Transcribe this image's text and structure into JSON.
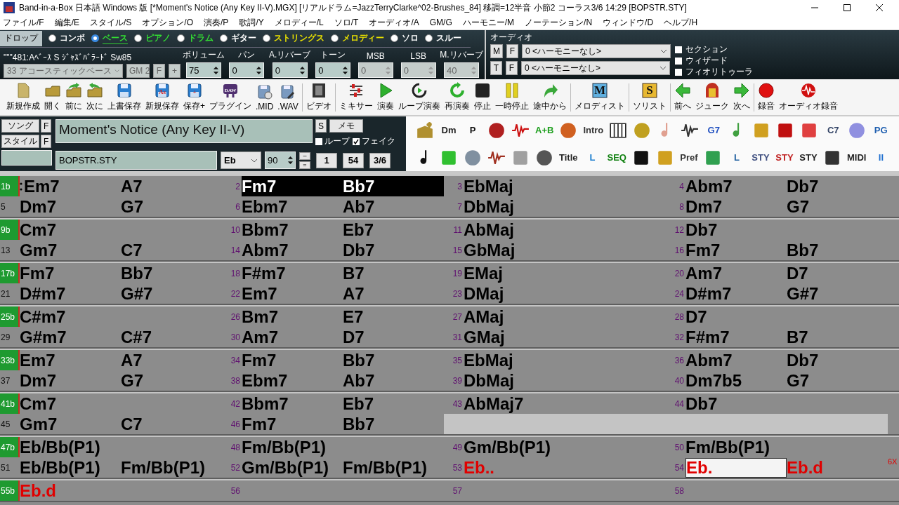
{
  "window": {
    "title": "Band-in-a-Box 日本語 Windows 版  [*Moment's Notice (Any Key II-V).MGX] [リアルドラム=JazzTerryClarke^02-Brushes_84] 移調=12半音 小節2 コーラス3/6  14:29  [BOPSTR.STY]"
  },
  "menu": [
    "ファイル/F",
    "編集/E",
    "スタイル/S",
    "オプション/O",
    "演奏/P",
    "歌詞/Y",
    "メロディー/L",
    "ソロ/T",
    "オーディオ/A",
    "GM/G",
    "ハーモニー/M",
    "ノーテーション/N",
    "ウィンドウ/D",
    "ヘルプ/H"
  ],
  "tracks": {
    "drop_button": "ドロップ",
    "items": [
      {
        "label": "コンボ",
        "color": "#ffffff",
        "selected": false
      },
      {
        "label": "ベース",
        "color": "#33dd33",
        "selected": true
      },
      {
        "label": "ピアノ",
        "color": "#33dd33",
        "selected": false
      },
      {
        "label": "ドラム",
        "color": "#33dd33",
        "selected": false
      },
      {
        "label": "ギター",
        "color": "#ffffff",
        "selected": false
      },
      {
        "label": "ストリングス",
        "color": "#e8e000",
        "selected": false
      },
      {
        "label": "メロディー",
        "color": "#e8e000",
        "selected": false
      },
      {
        "label": "ソロ",
        "color": "#ffffff",
        "selected": false
      },
      {
        "label": "スルー",
        "color": "#ffffff",
        "selected": false
      }
    ]
  },
  "patch": {
    "name": "\"\"\"481:Aﾍﾞｰｽ S ｼﾞｬｽﾞﾊﾞﾗｰﾄﾞ Sw85",
    "instrument": "33 アコースティックベース",
    "disabled": true,
    "buttons": [
      "GM 2",
      "F",
      "+"
    ]
  },
  "params": [
    {
      "label": "ボリューム",
      "value": "75",
      "disabled": false
    },
    {
      "label": "パン",
      "value": "0",
      "disabled": false
    },
    {
      "label": "A.リバーブ",
      "value": "0",
      "disabled": false
    },
    {
      "label": "トーン",
      "value": "0",
      "disabled": false
    },
    {
      "label": "MSB",
      "value": "0",
      "disabled": true
    },
    {
      "label": "LSB",
      "value": "0",
      "disabled": true
    },
    {
      "label": "M.リバーブ",
      "value": "40",
      "disabled": true
    }
  ],
  "audio": {
    "title": "オーディオ",
    "rows": [
      {
        "buttons": [
          "M",
          "F"
        ],
        "harmony": "0 <ハーモニーなし>"
      },
      {
        "buttons": [
          "T",
          "F"
        ],
        "harmony": "0 <ハーモニーなし>"
      }
    ],
    "options": [
      {
        "label": "セクション",
        "checked": false
      },
      {
        "label": "ウィザード",
        "checked": false
      },
      {
        "label": "フィオリトゥーラ",
        "checked": false
      }
    ]
  },
  "toolbar": [
    [
      {
        "label": "新規作成",
        "kind": "page"
      },
      {
        "label": "開く",
        "kind": "folder"
      },
      {
        "label": "前に",
        "kind": "folder-back"
      },
      {
        "label": "次に",
        "kind": "folder-next"
      },
      {
        "label": "上書保存",
        "kind": "disk"
      },
      {
        "label": "新規保存",
        "kind": "disk-text",
        "glyph": "As"
      },
      {
        "label": "保存+",
        "kind": "disk-text",
        "glyph": "+"
      },
      {
        "label": "プラグイン",
        "kind": "daw",
        "glyph": "DAW"
      },
      {
        "label": ".MID",
        "kind": "disk-dots"
      },
      {
        "label": ".WAV",
        "kind": "disk-mic"
      }
    ],
    [
      {
        "label": "ビデオ",
        "kind": "film"
      }
    ],
    [
      {
        "label": "ミキサー",
        "kind": "mixer"
      },
      {
        "label": "演奏",
        "kind": "play"
      },
      {
        "label": "ループ演奏",
        "kind": "loop"
      },
      {
        "label": "再演奏",
        "kind": "replay"
      },
      {
        "label": "停止",
        "kind": "stop"
      },
      {
        "label": "一時停止",
        "kind": "pause"
      },
      {
        "label": "途中から",
        "kind": "arrow"
      }
    ],
    [
      {
        "label": "メロディスト",
        "kind": "letter",
        "glyph": "M"
      }
    ],
    [
      {
        "label": "ソリスト",
        "kind": "letter-gold",
        "glyph": "S"
      }
    ],
    [
      {
        "label": "前へ",
        "kind": "left"
      },
      {
        "label": "ジューク",
        "kind": "jukebox"
      },
      {
        "label": "次へ",
        "kind": "right"
      }
    ],
    [
      {
        "label": "録音",
        "kind": "record"
      },
      {
        "label": "オーディオ録音",
        "kind": "audio-record"
      }
    ]
  ],
  "song": {
    "song_button": "ソング",
    "style_button": "スタイル",
    "f_buttons": [
      "F",
      "F"
    ],
    "title": "Moment's Notice (Any Key II-V)",
    "s_button": "S",
    "memo_button": "メモ",
    "loop": {
      "label": "ループ",
      "checked": false
    },
    "fake": {
      "label": "フェイク",
      "checked": true
    },
    "style": "BOPSTR.STY",
    "key": "Eb",
    "tempo": "90",
    "minus": "–",
    "equals": "=",
    "start_bar": "1",
    "end_bar": "54",
    "chorus": "3/6"
  },
  "icon_panel": [
    [
      {
        "kind": "heart",
        "color": "#b09030"
      },
      {
        "kind": "text",
        "text": "Dm",
        "color": "#222222"
      },
      {
        "kind": "text",
        "text": "P",
        "color": "#111111"
      },
      {
        "kind": "round",
        "color": "#b02020"
      },
      {
        "kind": "wave",
        "color": "#cc1010"
      },
      {
        "kind": "text",
        "text": "A+B",
        "color": "#20a020"
      },
      {
        "kind": "round",
        "color": "#d06020"
      },
      {
        "kind": "text",
        "text": "Intro",
        "color": "#333333"
      },
      {
        "kind": "keys",
        "color": "#222222"
      },
      {
        "kind": "round",
        "color": "#c0a020"
      },
      {
        "kind": "note",
        "color": "#e0a090"
      },
      {
        "kind": "wave",
        "color": "#333333"
      },
      {
        "kind": "text",
        "text": "G7",
        "color": "#2050c0"
      },
      {
        "kind": "note",
        "color": "#40a040"
      },
      {
        "kind": "box",
        "color": "#d0a020"
      },
      {
        "kind": "box",
        "color": "#c01010"
      },
      {
        "kind": "box",
        "color": "#e04040"
      },
      {
        "kind": "text",
        "text": "C7",
        "color": "#334466"
      },
      {
        "kind": "round",
        "color": "#9090e0"
      },
      {
        "kind": "text",
        "text": "PG",
        "color": "#2060b0"
      }
    ],
    [
      {
        "kind": "note",
        "color": "#111111"
      },
      {
        "kind": "box",
        "color": "#30c030"
      },
      {
        "kind": "round",
        "color": "#8090a0"
      },
      {
        "kind": "wave",
        "color": "#a03020"
      },
      {
        "kind": "box",
        "color": "#a0a0a0"
      },
      {
        "kind": "round",
        "color": "#555555"
      },
      {
        "kind": "text",
        "text": "Title",
        "color": "#222222"
      },
      {
        "kind": "text",
        "text": "L",
        "color": "#2080d0"
      },
      {
        "kind": "text",
        "text": "SEQ",
        "color": "#108010"
      },
      {
        "kind": "box",
        "color": "#111111"
      },
      {
        "kind": "box",
        "color": "#d0a020"
      },
      {
        "kind": "text",
        "text": "Pref",
        "color": "#333333"
      },
      {
        "kind": "box",
        "color": "#30a050"
      },
      {
        "kind": "text",
        "text": "L",
        "color": "#2060a0"
      },
      {
        "kind": "text",
        "text": "STY",
        "color": "#405080"
      },
      {
        "kind": "text",
        "text": "STY",
        "color": "#c02020"
      },
      {
        "kind": "text",
        "text": "STY",
        "color": "#222222"
      },
      {
        "kind": "box",
        "color": "#333333"
      },
      {
        "kind": "text",
        "text": "MIDI",
        "color": "#222222"
      },
      {
        "kind": "text",
        "text": "II",
        "color": "#2070d0"
      }
    ]
  ],
  "chord_sheet": [
    [
      {
        "cells": [
          {
            "number": "1b",
            "section": true,
            "repeat_start": true,
            "chords": [
              "Em7",
              "A7"
            ],
            "selected": false
          },
          {
            "number": "2",
            "chords": [
              "Fm7",
              "Bb7"
            ],
            "selected": true
          },
          {
            "number": "3",
            "chords": [
              "EbMaj"
            ],
            "selected": false
          },
          {
            "number": "4",
            "chords": [
              "Abm7",
              "Db7"
            ],
            "selected": false
          }
        ]
      },
      {
        "cells": [
          {
            "number": "5",
            "chords": [
              "Dm7",
              "G7"
            ],
            "selected": false
          },
          {
            "number": "6",
            "chords": [
              "Ebm7",
              "Ab7"
            ],
            "selected": false
          },
          {
            "number": "7",
            "chords": [
              "DbMaj"
            ],
            "selected": false
          },
          {
            "number": "8",
            "chords": [
              "Dm7",
              "G7"
            ],
            "selected": false
          }
        ]
      }
    ],
    [
      {
        "cells": [
          {
            "number": "9b",
            "section": true,
            "chords": [
              "Cm7"
            ],
            "selected": false
          },
          {
            "number": "10",
            "chords": [
              "Bbm7",
              "Eb7"
            ],
            "selected": false
          },
          {
            "number": "11",
            "chords": [
              "AbMaj"
            ],
            "selected": false
          },
          {
            "number": "12",
            "chords": [
              "Db7"
            ],
            "selected": false
          }
        ]
      },
      {
        "cells": [
          {
            "number": "13",
            "chords": [
              "Gm7",
              "C7"
            ],
            "selected": false
          },
          {
            "number": "14",
            "chords": [
              "Abm7",
              "Db7"
            ],
            "selected": false
          },
          {
            "number": "15",
            "chords": [
              "GbMaj"
            ],
            "selected": false
          },
          {
            "number": "16",
            "chords": [
              "Fm7",
              "Bb7"
            ],
            "selected": false
          }
        ]
      }
    ],
    [
      {
        "cells": [
          {
            "number": "17b",
            "section": true,
            "chords": [
              "Fm7",
              "Bb7"
            ],
            "selected": false
          },
          {
            "number": "18",
            "chords": [
              "F#m7",
              "B7"
            ],
            "selected": false
          },
          {
            "number": "19",
            "chords": [
              "EMaj"
            ],
            "selected": false
          },
          {
            "number": "20",
            "chords": [
              "Am7",
              "D7"
            ],
            "selected": false
          }
        ]
      },
      {
        "cells": [
          {
            "number": "21",
            "chords": [
              "D#m7",
              "G#7"
            ],
            "selected": false
          },
          {
            "number": "22",
            "chords": [
              "Em7",
              "A7"
            ],
            "selected": false
          },
          {
            "number": "23",
            "chords": [
              "DMaj"
            ],
            "selected": false
          },
          {
            "number": "24",
            "chords": [
              "D#m7",
              "G#7"
            ],
            "selected": false
          }
        ]
      }
    ],
    [
      {
        "cells": [
          {
            "number": "25b",
            "section": true,
            "chords": [
              "C#m7"
            ],
            "selected": false
          },
          {
            "number": "26",
            "chords": [
              "Bm7",
              "E7"
            ],
            "selected": false
          },
          {
            "number": "27",
            "chords": [
              "AMaj"
            ],
            "selected": false
          },
          {
            "number": "28",
            "chords": [
              "D7"
            ],
            "selected": false
          }
        ]
      },
      {
        "cells": [
          {
            "number": "29",
            "chords": [
              "G#m7",
              "C#7"
            ],
            "selected": false
          },
          {
            "number": "30",
            "chords": [
              "Am7",
              "D7"
            ],
            "selected": false
          },
          {
            "number": "31",
            "chords": [
              "GMaj"
            ],
            "selected": false
          },
          {
            "number": "32",
            "chords": [
              "F#m7",
              "B7"
            ],
            "selected": false
          }
        ]
      }
    ],
    [
      {
        "cells": [
          {
            "number": "33b",
            "section": true,
            "chords": [
              "Em7",
              "A7"
            ],
            "selected": false
          },
          {
            "number": "34",
            "chords": [
              "Fm7",
              "Bb7"
            ],
            "selected": false
          },
          {
            "number": "35",
            "chords": [
              "EbMaj"
            ],
            "selected": false
          },
          {
            "number": "36",
            "chords": [
              "Abm7",
              "Db7"
            ],
            "selected": false
          }
        ]
      },
      {
        "cells": [
          {
            "number": "37",
            "chords": [
              "Dm7",
              "G7"
            ],
            "selected": false
          },
          {
            "number": "38",
            "chords": [
              "Ebm7",
              "Ab7"
            ],
            "selected": false
          },
          {
            "number": "39",
            "chords": [
              "DbMaj"
            ],
            "selected": false
          },
          {
            "number": "40",
            "chords": [
              "Dm7b5",
              "G7"
            ],
            "selected": false
          }
        ]
      }
    ],
    [
      {
        "cells": [
          {
            "number": "41b",
            "section": true,
            "chords": [
              "Cm7"
            ],
            "selected": false
          },
          {
            "number": "42",
            "chords": [
              "Bbm7",
              "Eb7"
            ],
            "selected": false
          },
          {
            "number": "43",
            "chords": [
              "AbMaj7"
            ],
            "selected": false
          },
          {
            "number": "44",
            "chords": [
              "Db7"
            ],
            "selected": false
          }
        ]
      },
      {
        "cells": [
          {
            "number": "45",
            "chords": [
              "Gm7",
              "C7"
            ],
            "selected": false
          },
          {
            "number": "46",
            "chords": [
              "Fm7",
              "Bb7"
            ],
            "selected": false
          },
          {
            "kind": "empty"
          },
          {
            "kind": "empty"
          }
        ]
      }
    ],
    [
      {
        "cells": [
          {
            "number": "47b",
            "section": true,
            "chords": [
              "Eb/Bb(P1)"
            ],
            "selected": false
          },
          {
            "number": "48",
            "chords": [
              "Fm/Bb(P1)"
            ],
            "selected": false
          },
          {
            "number": "49",
            "chords": [
              "Gm/Bb(P1)"
            ],
            "selected": false
          },
          {
            "number": "50",
            "chords": [
              "Fm/Bb(P1)"
            ],
            "selected": false
          }
        ]
      },
      {
        "end_mark": "6X",
        "cells": [
          {
            "number": "51",
            "chords": [
              "Eb/Bb(P1)",
              "Fm/Bb(P1)"
            ],
            "selected": false
          },
          {
            "number": "52",
            "chords": [
              "Gm/Bb(P1)",
              "Fm/Bb(P1)"
            ],
            "selected": false
          },
          {
            "number": "53",
            "chords": [
              "Eb.."
            ],
            "color": "#e00000",
            "selected": false
          },
          {
            "number": "54",
            "chords": [
              "Eb.",
              "Eb.d"
            ],
            "color": "#e00000",
            "editing": true,
            "selected": false
          }
        ]
      }
    ],
    [
      {
        "cells": [
          {
            "number": "55b",
            "section": true,
            "chords": [
              "Eb.d"
            ],
            "color": "#e00000",
            "selected": false
          },
          {
            "number": "56",
            "selected": false
          },
          {
            "number": "57",
            "selected": false
          },
          {
            "number": "58",
            "selected": false
          }
        ]
      }
    ]
  ]
}
